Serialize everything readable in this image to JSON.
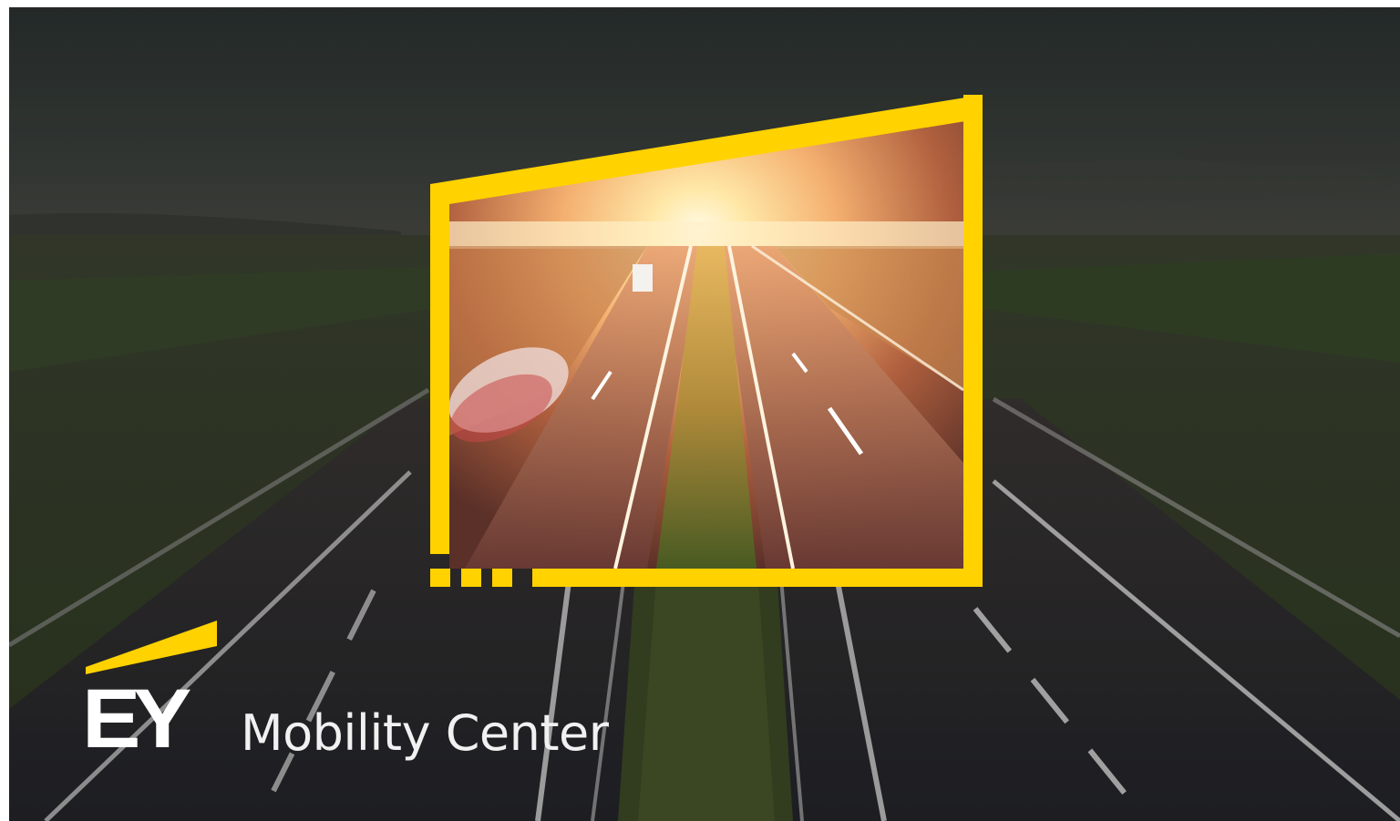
{
  "logo": {
    "brand_letters": "EY",
    "accent_color": "#FFD200"
  },
  "tagline": "Mobility Center",
  "colors": {
    "frame_yellow": "#FFD200",
    "sky_dark": "#2a302e",
    "road_dark": "#2b2b30",
    "grass_dark": "#3a4228",
    "sunset_glow": "#ffd890"
  }
}
